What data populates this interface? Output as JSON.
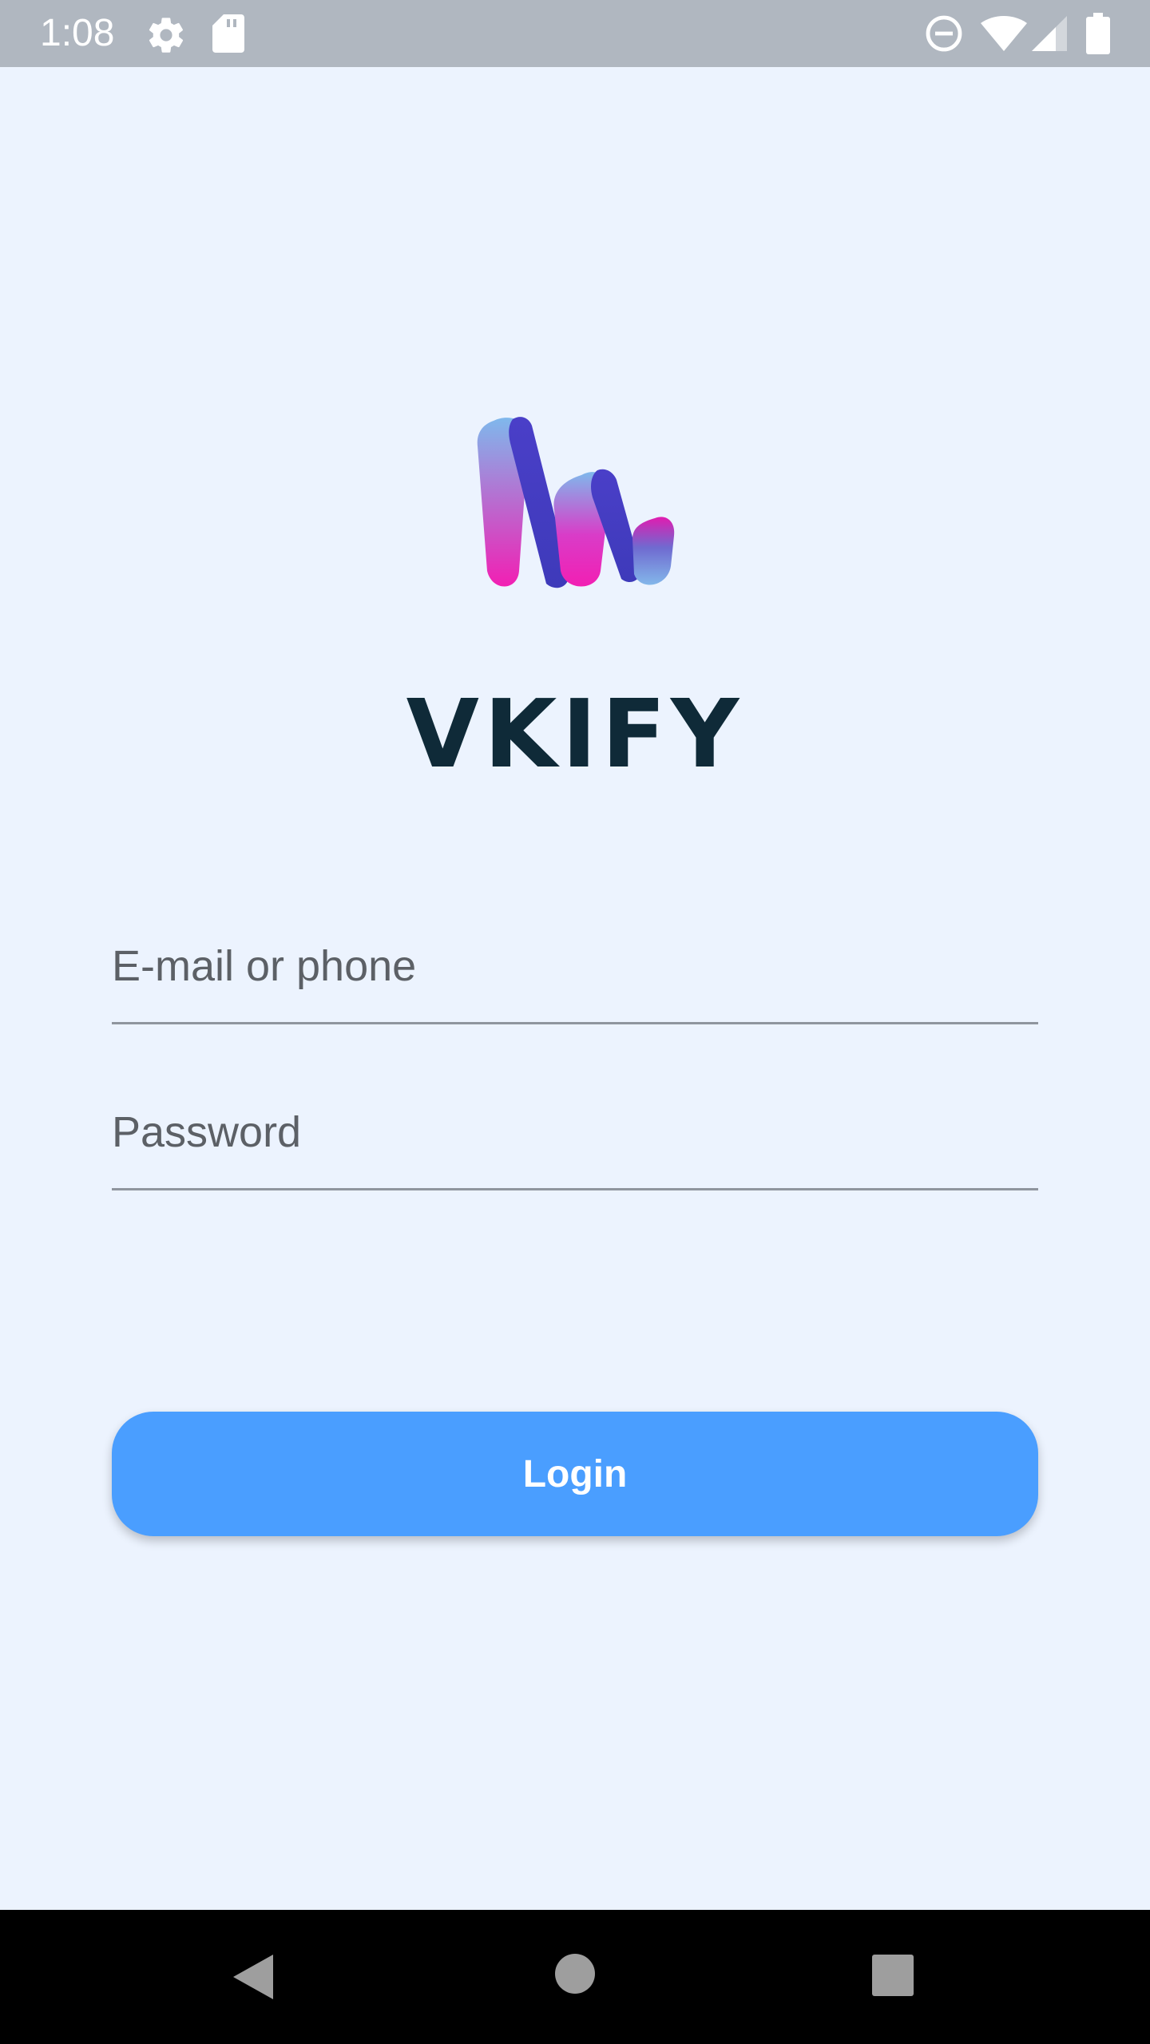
{
  "status_bar": {
    "time": "1:08",
    "icons": [
      "gear-icon",
      "sd-card-icon",
      "do-not-disturb-icon",
      "wifi-icon",
      "cell-signal-icon",
      "battery-icon"
    ]
  },
  "brand": {
    "name": "VKIFY",
    "logo_colors": {
      "pink": "#f21fb3",
      "light_blue": "#7fb8ec",
      "purple": "#4a3fc8"
    }
  },
  "login_form": {
    "email_placeholder": "E-mail or phone",
    "password_placeholder": "Password",
    "login_label": "Login"
  },
  "nav_bar": {
    "buttons": [
      "back-icon",
      "home-icon",
      "recents-icon"
    ]
  },
  "colors": {
    "background": "#ecf3fe",
    "status_bar": "#b0b7c0",
    "button": "#4a9eff",
    "brand_text": "#0f2a38"
  }
}
